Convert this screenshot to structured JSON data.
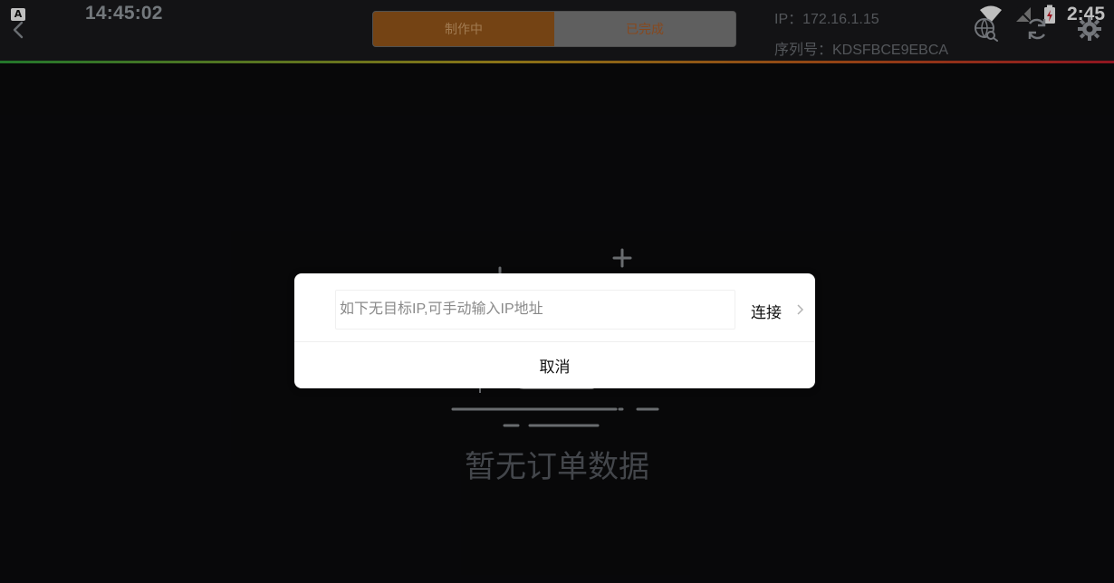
{
  "status_bar": {
    "left_time": "14:45:02",
    "right_time": "2:45",
    "a_badge": "A"
  },
  "tabs": {
    "making": "制作中",
    "done": "已完成"
  },
  "device": {
    "ip": "IP：172.16.1.15",
    "serial": "序列号：KDSFBCE9EBCA"
  },
  "empty_state": {
    "text": "暂无订单数据"
  },
  "dialog": {
    "input_placeholder": "如下无目标IP,可手动输入IP地址",
    "connect_label": "连接",
    "cancel_label": "取消"
  },
  "colors": {
    "accent_orange": "#9b5a1b",
    "tab_inactive": "#7f7f7f"
  },
  "icons": {
    "back": "chevron-left-icon",
    "globe_search": "globe-search-icon",
    "refresh": "refresh-icon",
    "settings": "gear-icon",
    "wifi": "wifi-icon",
    "signal": "signal-icon",
    "battery": "battery-icon",
    "connect_chevron": "chevron-right-icon"
  }
}
